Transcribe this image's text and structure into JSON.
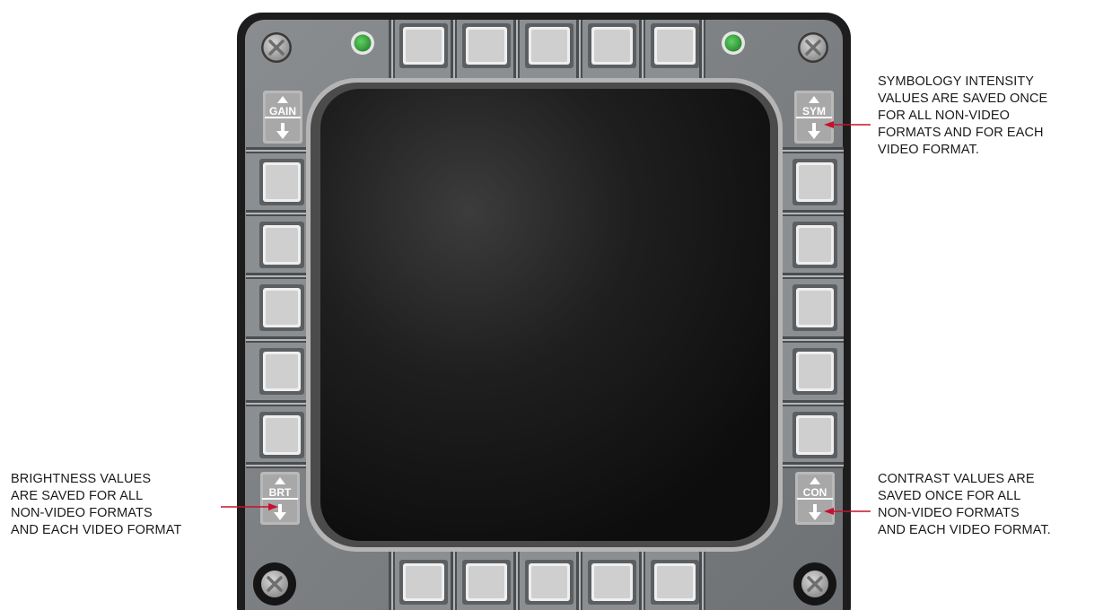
{
  "colors": {
    "bezel": "#7b7e81",
    "bezel_edge": "#1b1b1b",
    "screen": "#161616",
    "button_face": "#cfcfcf",
    "indicator": "#3fae45",
    "arrow": "#c8102e"
  },
  "rockers": {
    "gain": {
      "label": "GAIN"
    },
    "sym": {
      "label": "SYM"
    },
    "brt": {
      "label": "BRT"
    },
    "con": {
      "label": "CON"
    }
  },
  "icons": {
    "screw": "screw-icon",
    "indicator": "indicator-light-icon",
    "up": "up-arrow-icon",
    "down": "down-arrow-icon"
  },
  "annotations": {
    "sym": {
      "lines": [
        "SYMBOLOGY INTENSITY",
        "VALUES ARE SAVED ONCE",
        "FOR ALL NON-VIDEO",
        "FORMATS AND FOR EACH",
        "VIDEO FORMAT."
      ]
    },
    "brt": {
      "lines": [
        "BRIGHTNESS VALUES",
        "ARE SAVED FOR ALL",
        "NON-VIDEO FORMATS",
        "AND EACH VIDEO FORMAT"
      ]
    },
    "con": {
      "lines": [
        "CONTRAST VALUES ARE",
        "SAVED ONCE FOR ALL",
        "NON-VIDEO FORMATS",
        "AND EACH VIDEO FORMAT."
      ]
    }
  }
}
